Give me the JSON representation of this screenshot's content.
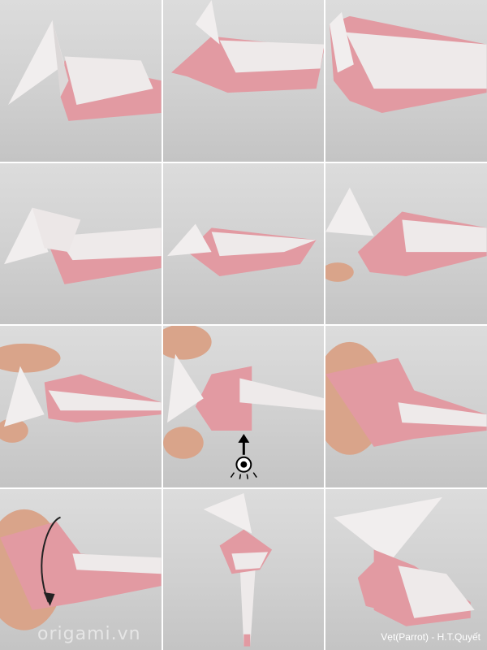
{
  "watermark": "origami.vn",
  "credit": "Vẹt(Parrot) - H.T.Quyết",
  "colors": {
    "pink": "#e29aa2",
    "white_paper": "#eeeaea",
    "skin": "#d9a48a",
    "background": "#d3d3d3"
  },
  "icons": [
    "eye-view-icon",
    "arrow-up-icon",
    "curved-arrow-icon"
  ]
}
